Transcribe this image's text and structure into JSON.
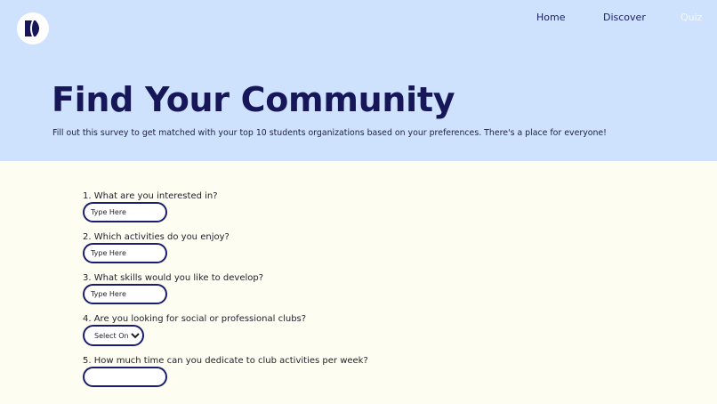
{
  "nav": {
    "links": [
      {
        "label": "Home"
      },
      {
        "label": "Discover"
      },
      {
        "label": "Quiz"
      }
    ]
  },
  "hero": {
    "title": "Find Your Community",
    "subtitle": "Fill out this survey to get matched with your top 10 students organizations based on your preferences. There's a place for everyone!"
  },
  "survey": {
    "questions": [
      {
        "label": "1. What are you interested in?",
        "placeholder": "Type Here",
        "value": ""
      },
      {
        "label": "2. Which activities do you enjoy?",
        "placeholder": "Type Here",
        "value": ""
      },
      {
        "label": "3. What skills would you like to develop?",
        "placeholder": "Type Here",
        "value": ""
      },
      {
        "label": "4. Are you looking for social or professional clubs?",
        "selected": "Select One"
      },
      {
        "label": "5. How much time can you dedicate to club activities per week?",
        "placeholder": "",
        "value": ""
      }
    ]
  },
  "colors": {
    "hero_bg": "#cfe2fd",
    "page_bg": "#fdfdf1",
    "accent": "#1b1d6e"
  },
  "icons": {
    "logo": "brand-logo-icon"
  }
}
